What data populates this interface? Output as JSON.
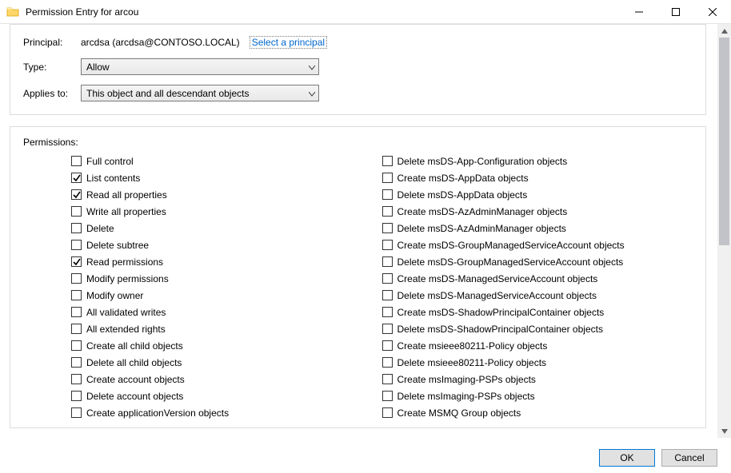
{
  "window": {
    "title": "Permission Entry for arcou"
  },
  "principal_row": {
    "label": "Principal:",
    "value": "arcdsa (arcdsa@CONTOSO.LOCAL)",
    "link": "Select a principal"
  },
  "type_row": {
    "label": "Type:",
    "value": "Allow"
  },
  "applies_row": {
    "label": "Applies to:",
    "value": "This object and all descendant objects"
  },
  "permissions": {
    "heading": "Permissions:",
    "left": [
      {
        "label": "Full control",
        "checked": false
      },
      {
        "label": "List contents",
        "checked": true
      },
      {
        "label": "Read all properties",
        "checked": true
      },
      {
        "label": "Write all properties",
        "checked": false
      },
      {
        "label": "Delete",
        "checked": false
      },
      {
        "label": "Delete subtree",
        "checked": false
      },
      {
        "label": "Read permissions",
        "checked": true
      },
      {
        "label": "Modify permissions",
        "checked": false
      },
      {
        "label": "Modify owner",
        "checked": false
      },
      {
        "label": "All validated writes",
        "checked": false
      },
      {
        "label": "All extended rights",
        "checked": false
      },
      {
        "label": "Create all child objects",
        "checked": false
      },
      {
        "label": "Delete all child objects",
        "checked": false
      },
      {
        "label": "Create account objects",
        "checked": false
      },
      {
        "label": "Delete account objects",
        "checked": false
      },
      {
        "label": "Create applicationVersion objects",
        "checked": false
      }
    ],
    "right": [
      {
        "label": "Delete msDS-App-Configuration objects",
        "checked": false
      },
      {
        "label": "Create msDS-AppData objects",
        "checked": false
      },
      {
        "label": "Delete msDS-AppData objects",
        "checked": false
      },
      {
        "label": "Create msDS-AzAdminManager objects",
        "checked": false
      },
      {
        "label": "Delete msDS-AzAdminManager objects",
        "checked": false
      },
      {
        "label": "Create msDS-GroupManagedServiceAccount objects",
        "checked": false
      },
      {
        "label": "Delete msDS-GroupManagedServiceAccount objects",
        "checked": false
      },
      {
        "label": "Create msDS-ManagedServiceAccount objects",
        "checked": false
      },
      {
        "label": "Delete msDS-ManagedServiceAccount objects",
        "checked": false
      },
      {
        "label": "Create msDS-ShadowPrincipalContainer objects",
        "checked": false
      },
      {
        "label": "Delete msDS-ShadowPrincipalContainer objects",
        "checked": false
      },
      {
        "label": "Create msieee80211-Policy objects",
        "checked": false
      },
      {
        "label": "Delete msieee80211-Policy objects",
        "checked": false
      },
      {
        "label": "Create msImaging-PSPs objects",
        "checked": false
      },
      {
        "label": "Delete msImaging-PSPs objects",
        "checked": false
      },
      {
        "label": "Create MSMQ Group objects",
        "checked": false
      }
    ]
  },
  "buttons": {
    "ok": "OK",
    "cancel": "Cancel"
  }
}
